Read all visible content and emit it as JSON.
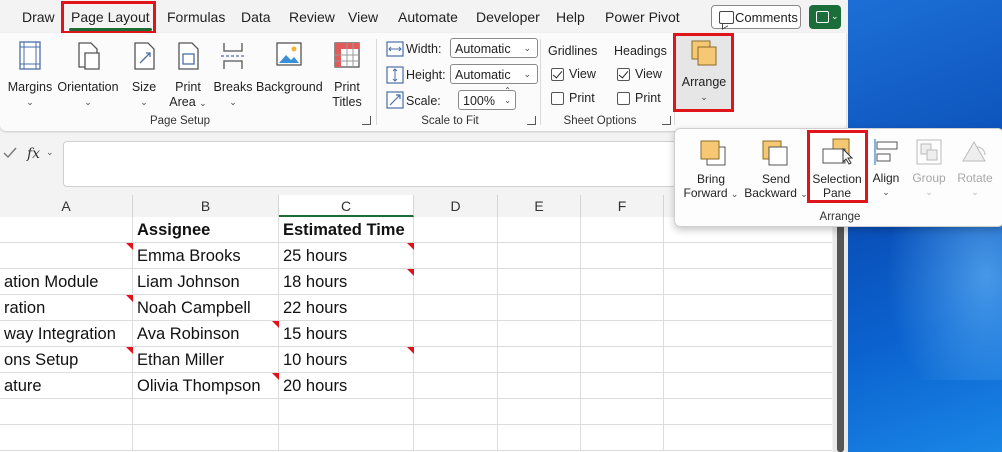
{
  "tabs": [
    "Draw",
    "Page Layout",
    "Formulas",
    "Data",
    "Review",
    "View",
    "Automate",
    "Developer",
    "Help",
    "Power Pivot"
  ],
  "active_tab": "Page Layout",
  "comments_label": "Comments",
  "ribbon": {
    "page_setup": {
      "label": "Page Setup",
      "margins": "Margins",
      "orientation": "Orientation",
      "size": "Size",
      "print_area_1": "Print",
      "print_area_2": "Area",
      "breaks": "Breaks",
      "background": "Background",
      "print_titles_1": "Print",
      "print_titles_2": "Titles"
    },
    "scale_to_fit": {
      "label": "Scale to Fit",
      "width_label": "Width:",
      "width_value": "Automatic",
      "height_label": "Height:",
      "height_value": "Automatic",
      "scale_label": "Scale:",
      "scale_value": "100%"
    },
    "sheet_options": {
      "label": "Sheet Options",
      "gridlines": "Gridlines",
      "headings": "Headings",
      "gridlines_view": "View",
      "gridlines_print": "Print",
      "headings_view": "View",
      "headings_print": "Print",
      "gridlines_view_checked": true,
      "gridlines_print_checked": false,
      "headings_view_checked": true,
      "headings_print_checked": false
    },
    "arrange_label": "Arrange"
  },
  "formula_bar": {
    "fx": "fx",
    "value": ""
  },
  "columns": [
    "A",
    "B",
    "C",
    "D",
    "E",
    "F"
  ],
  "selected_column": "C",
  "rows": [
    {
      "a": "",
      "b": "Assignee",
      "c": "Estimated Time",
      "header": true
    },
    {
      "a": "",
      "b": "Emma Brooks",
      "c": "25 hours"
    },
    {
      "a": "ation Module",
      "b": "Liam Johnson",
      "c": "18 hours"
    },
    {
      "a": "ration",
      "b": "Noah Campbell",
      "c": "22 hours"
    },
    {
      "a": "way Integration",
      "b": "Ava Robinson",
      "c": "15 hours"
    },
    {
      "a": "ons Setup",
      "b": "Ethan Miller",
      "c": "10 hours"
    },
    {
      "a": "ature",
      "b": "Olivia Thompson",
      "c": "20 hours"
    },
    {
      "a": "",
      "b": "",
      "c": ""
    }
  ],
  "flyout": {
    "group_label": "Arrange",
    "bring_forward_1": "Bring",
    "bring_forward_2": "Forward",
    "send_backward_1": "Send",
    "send_backward_2": "Backward",
    "selection_pane_1": "Selection",
    "selection_pane_2": "Pane",
    "align": "Align",
    "group": "Group",
    "rotate": "Rotate"
  },
  "colors": {
    "accent": "#1d6b35",
    "highlight": "#e0151b",
    "shape_fill": "#f7c873"
  }
}
